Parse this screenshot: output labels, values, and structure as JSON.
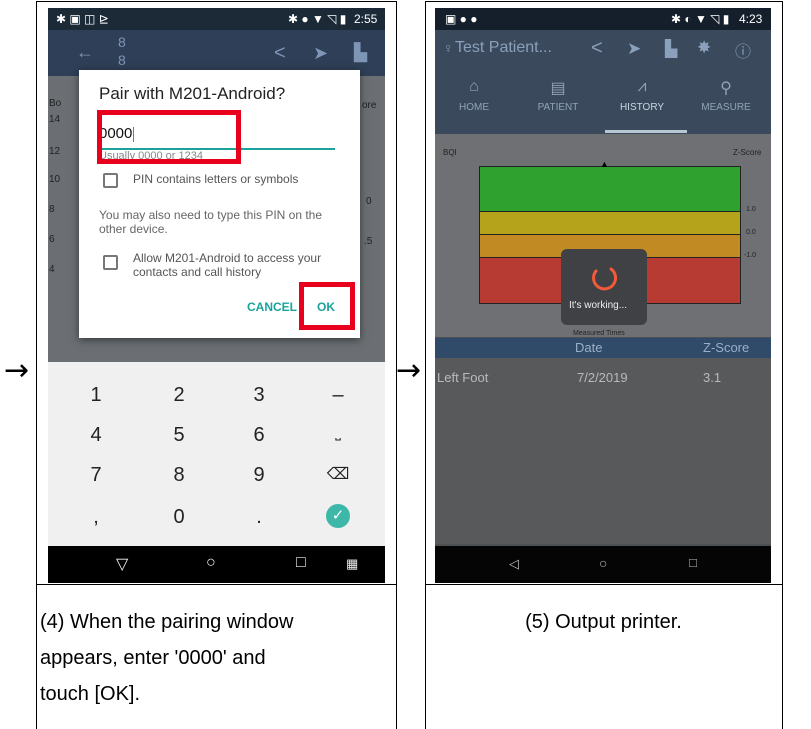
{
  "arrows": [
    "→",
    "→"
  ],
  "left_phone": {
    "statusbar": {
      "left_icons": "✱ ▣ ◫ ⊵",
      "right_icons": "✱ ● ▼ ◹ ▮",
      "time": "2:55"
    },
    "appbar": {
      "back_icon": "←",
      "number_top": "8",
      "number_bottom": "8",
      "share_icon": "<",
      "send_icon": "➤",
      "print_icon": "▙"
    },
    "background_fragments": [
      "Bo",
      "14",
      "12",
      "10",
      "8",
      "6",
      "4",
      "ore",
      "0",
      ".5"
    ],
    "dialog": {
      "title": "Pair with M201-Android?",
      "pin_value": "0000",
      "hint": "Usually 0000 or 1234",
      "pin_letters_label": "PIN contains letters or symbols",
      "note": "You may also need to type this PIN on the other device.",
      "allow_access_label": "Allow M201-Android to access your contacts and call history",
      "cancel_label": "CANCEL",
      "ok_label": "OK"
    },
    "keypad": {
      "keys": [
        "1",
        "2",
        "3",
        "–",
        "4",
        "5",
        "6",
        "⎵",
        "7",
        "8",
        "9",
        "⌫",
        ",",
        "0",
        ".",
        "✓"
      ]
    },
    "navbar": {
      "back": "▽",
      "home": "○",
      "recent": "□",
      "keyboard": "▦"
    }
  },
  "right_phone": {
    "statusbar": {
      "left_icons": "▣ ● ●",
      "right_icons": "✱ ◐ ▼ ◹ ▮",
      "time": "4:23"
    },
    "appbar": {
      "patient_label": "Test Patient...",
      "pin_icon": "♀",
      "share_icon": "<",
      "send_icon": "➤",
      "print_icon": "▙",
      "gear_icon": "✸",
      "info_icon": "ⓘ"
    },
    "tabs": [
      {
        "label": "HOME",
        "icon": "⌂"
      },
      {
        "label": "PATIENT",
        "icon": "▤"
      },
      {
        "label": "HISTORY",
        "icon": "⩘"
      },
      {
        "label": "MEASURE",
        "icon": "⚲"
      }
    ],
    "chart": {
      "left_label": "BQI",
      "right_label": "Z-Score",
      "tick_labels": [
        "1.0",
        "0.0",
        "-1.0"
      ],
      "x_caption": "Measured Times",
      "bands": [
        {
          "color": "#2fa12f"
        },
        {
          "color": "#b5a31c"
        },
        {
          "color": "#c18a23"
        },
        {
          "color": "#b83b33"
        }
      ]
    },
    "loader_text": "It's working...",
    "table": {
      "headers": [
        "Date",
        "Z-Score"
      ],
      "rows": [
        {
          "site": "Left Foot",
          "date": "7/2/2019",
          "zscore": "3.1"
        }
      ]
    },
    "navbar": {
      "back": "◁",
      "home": "○",
      "recent": "□"
    }
  },
  "captions": {
    "step4": [
      "(4) When the pairing window",
      "appears, enter '0000' and",
      "touch [OK]."
    ],
    "step5": "(5) Output printer."
  }
}
